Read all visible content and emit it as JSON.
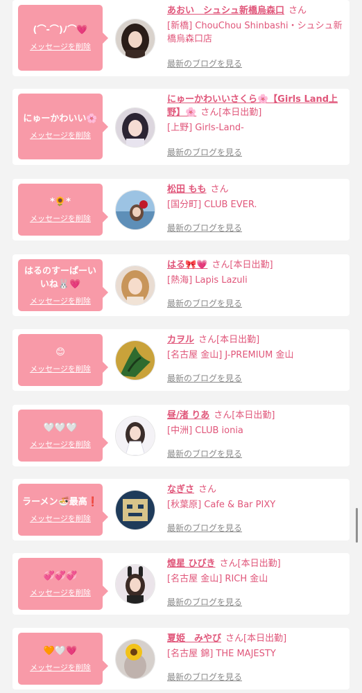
{
  "delete_label": "メッセージを削除",
  "blog_label": "最新のブログを見る",
  "san_label": "さん",
  "colors": {
    "accent": "#e0567a",
    "bubble": "#f89aa8",
    "background": "#f3f3f3"
  },
  "favorites": [
    {
      "message": "(⌒-⌒)ﾉ⌒💗",
      "name": "あおい　シュシュ新橋烏森口",
      "status": "",
      "shop": "[新橋] ChouChou Shinbashi・シュシュ新橋烏森口店",
      "avatar_icon": "dark-hair-portrait"
    },
    {
      "message": "にゅーかわいい🌸",
      "name": "にゅーかわいいさくら🌸【Girls Land上野】🌸",
      "status": "[本日出勤]",
      "shop": "[上野] Girls-Land-",
      "avatar_icon": "idol-portrait"
    },
    {
      "message": "*🌻*",
      "name": "松田 もも",
      "status": "",
      "shop": "[国分町] CLUB EVER.",
      "avatar_icon": "seaside-portrait"
    },
    {
      "message": "はるのすーぱーいいね🐰💗",
      "name": "はる🎀💗",
      "status": "[本日出勤]",
      "shop": "[熱海] Lapis Lazuli",
      "avatar_icon": "blonde-portrait"
    },
    {
      "message": "😊",
      "name": "カヲル",
      "status": "[本日出勤]",
      "shop": "[名古屋 金山] J-PREMIUM 金山",
      "avatar_icon": "plant-photo"
    },
    {
      "message": "🤍🤍🤍",
      "name": "昼/渚 りあ",
      "status": "[本日出勤]",
      "shop": "[中洲] CLUB ionia",
      "avatar_icon": "white-dress-portrait"
    },
    {
      "message": "ラーメン🍜最高❗️",
      "name": "なぎさ",
      "status": "",
      "shop": "[秋葉原] Cafe & Bar PIXY",
      "avatar_icon": "pixel-face"
    },
    {
      "message": "💞💞💞",
      "name": "煌星 ひびき",
      "status": "[本日出勤]",
      "shop": "[名古屋 金山] RICH 金山",
      "avatar_icon": "bunny-portrait"
    },
    {
      "message": "🧡🤍💗",
      "name": "夏姫　みやび",
      "status": "[本日出勤]",
      "shop": "[名古屋 錦] THE MAJESTY",
      "avatar_icon": "sunflower-portrait"
    }
  ]
}
